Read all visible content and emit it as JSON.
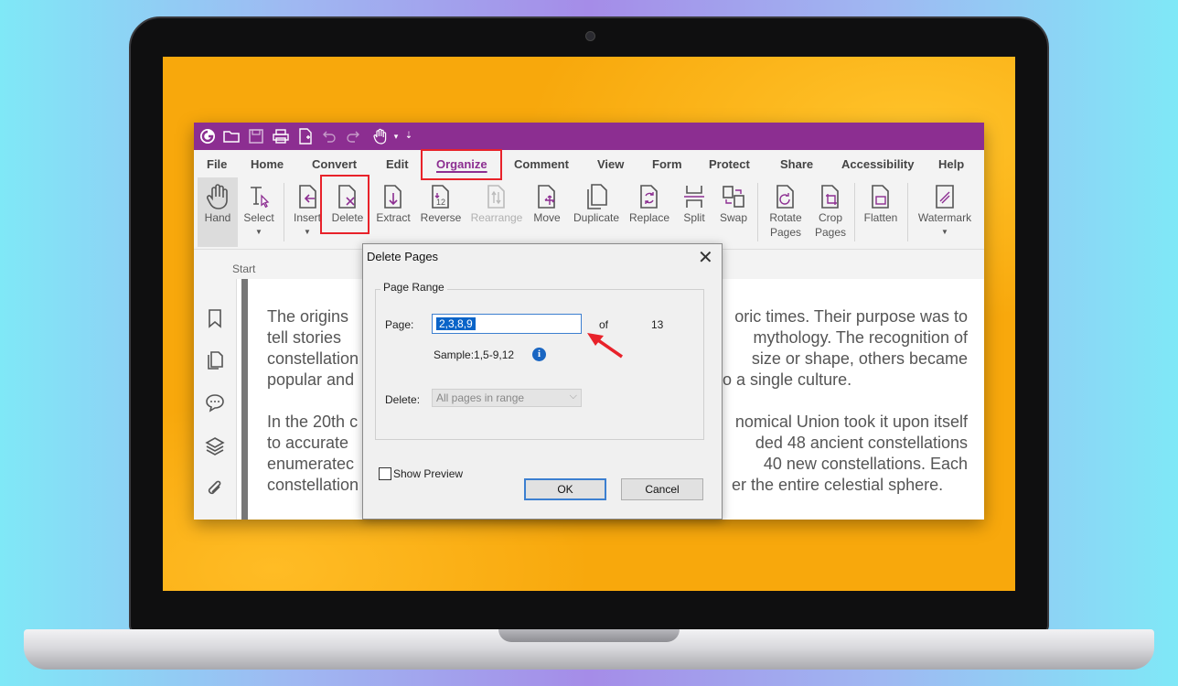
{
  "quick_access": {
    "icons": [
      "foxit-logo-icon",
      "open-folder-icon",
      "save-icon",
      "print-icon",
      "new-page-icon",
      "undo-icon",
      "redo-icon",
      "hand-icon",
      "dropdown-icon"
    ]
  },
  "menu": {
    "items": [
      "File",
      "Home",
      "Convert",
      "Edit",
      "Organize",
      "Comment",
      "View",
      "Form",
      "Protect",
      "Share",
      "Accessibility",
      "Help"
    ],
    "active": "Organize",
    "active_color": "#8c2e91"
  },
  "ribbon": {
    "buttons": [
      {
        "label": "Hand",
        "icon": "hand-icon"
      },
      {
        "label": "Select",
        "icon": "select-icon"
      },
      {
        "label": "Insert",
        "icon": "insert-page-icon"
      },
      {
        "label": "Delete",
        "icon": "delete-page-icon"
      },
      {
        "label": "Extract",
        "icon": "extract-page-icon"
      },
      {
        "label": "Reverse",
        "icon": "reverse-pages-icon"
      },
      {
        "label": "Rearrange",
        "icon": "rearrange-icon"
      },
      {
        "label": "Move",
        "icon": "move-page-icon"
      },
      {
        "label": "Duplicate",
        "icon": "duplicate-icon"
      },
      {
        "label": "Replace",
        "icon": "replace-icon"
      },
      {
        "label": "Split",
        "icon": "split-icon"
      },
      {
        "label": "Swap",
        "icon": "swap-icon"
      },
      {
        "label": "Rotate Pages",
        "icon": "rotate-pages-icon"
      },
      {
        "label": "Crop Pages",
        "icon": "crop-pages-icon"
      },
      {
        "label": "Flatten",
        "icon": "flatten-icon"
      },
      {
        "label": "Watermark",
        "icon": "watermark-icon"
      }
    ]
  },
  "tabs": {
    "start": "Start"
  },
  "nav_panel": {
    "icons": [
      "bookmark-icon",
      "pages-icon",
      "comments-icon",
      "layers-icon",
      "attachment-icon"
    ]
  },
  "document": {
    "paragraphs": [
      "The origins tell stories constellation popular and",
      "In the 20th to accurate enumerated constellation"
    ],
    "right_fragments": [
      "oric times. Their purpose was to",
      "mythology. The recognition of",
      "size or shape, others became",
      "to a single culture.",
      "nomical Union took it upon itself",
      "ded 48 ancient constellations",
      "40 new constellations. Each",
      "er the entire celestial sphere."
    ],
    "left_fragments": [
      "The origins",
      "tell stories",
      "constellation",
      "popular and",
      "In the 20th c",
      "to accurate",
      "enumeratec",
      "constellation"
    ]
  },
  "dialog": {
    "title": "Delete Pages",
    "close": "✕",
    "group_label": "Page Range",
    "page_label": "Page:",
    "page_value": "2,3,8,9",
    "of_label": "of",
    "total_pages": "13",
    "sample": "Sample:1,5-9,12",
    "delete_label": "Delete:",
    "delete_option": "All pages in range",
    "show_preview": "Show Preview",
    "ok": "OK",
    "cancel": "Cancel"
  },
  "colors": {
    "titlebar": "#8c2e91",
    "highlight": "#e8222a",
    "accent": "#3c7fd0"
  }
}
